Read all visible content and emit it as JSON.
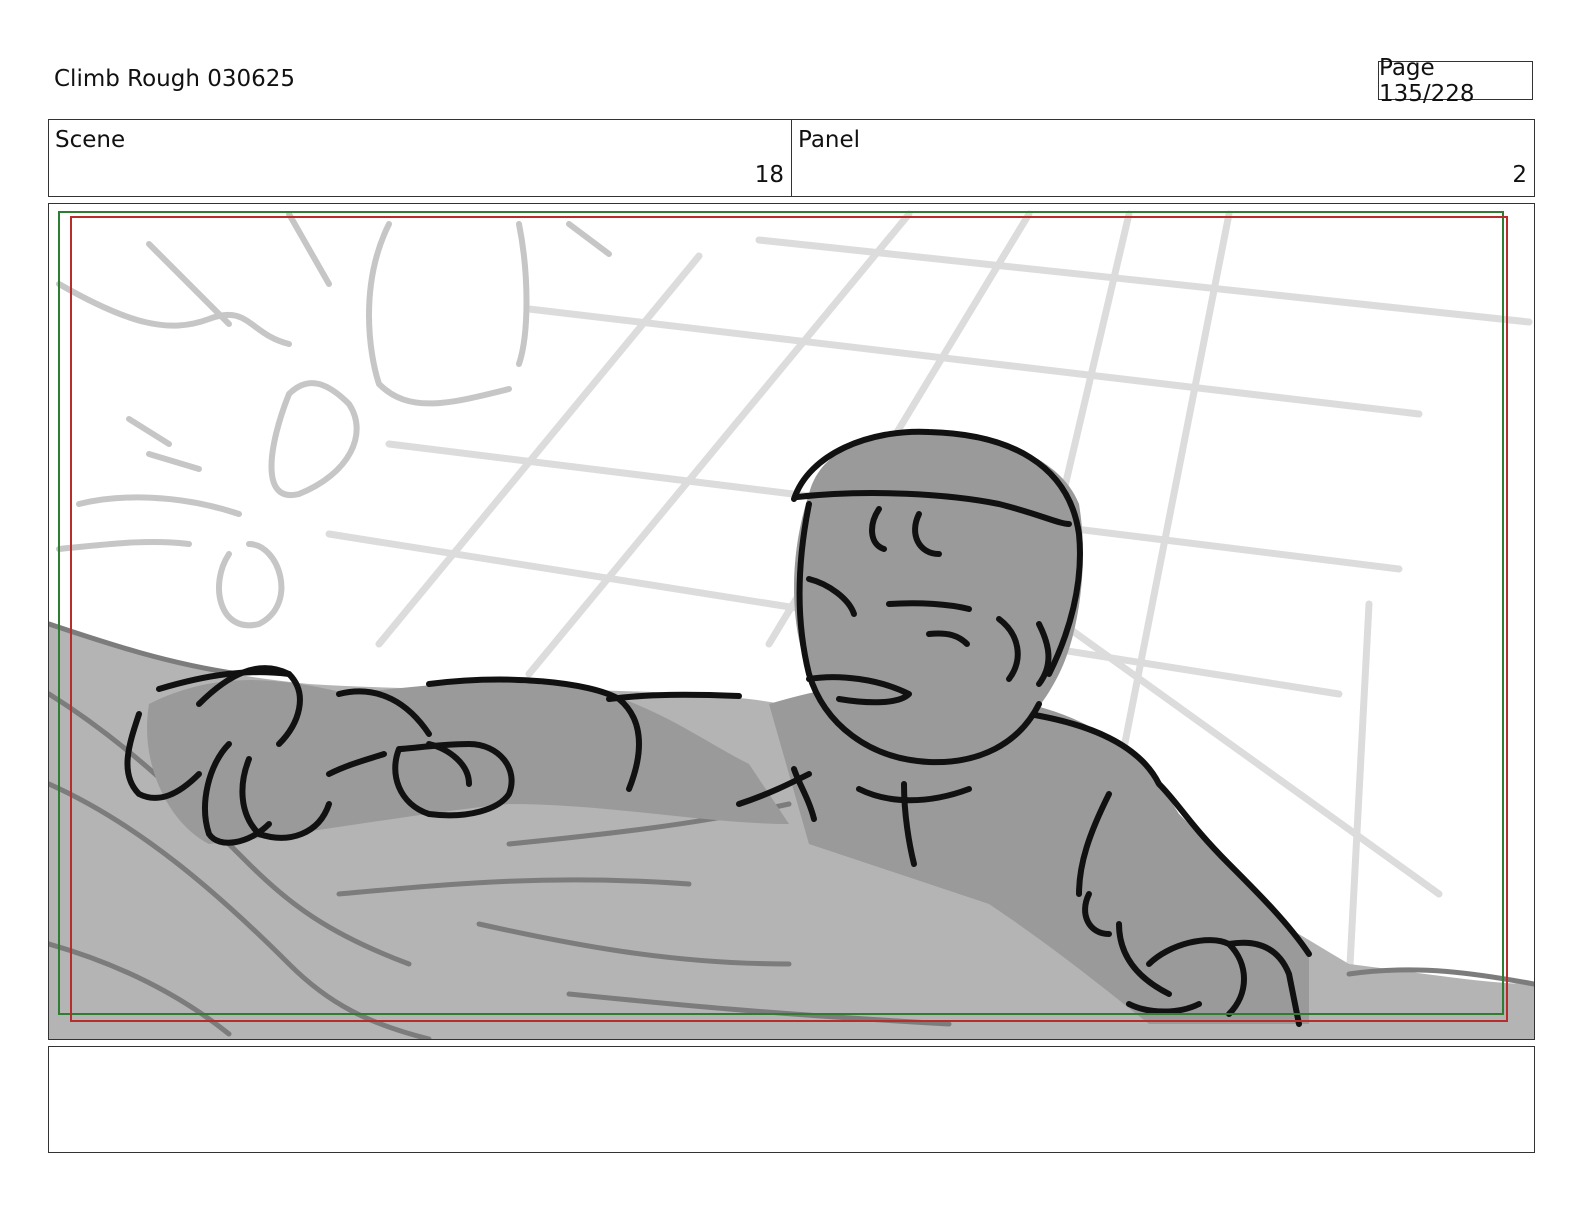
{
  "header": {
    "document_title": "Climb Rough 030625",
    "page_indicator": "Page 135/228"
  },
  "scene": {
    "label": "Scene",
    "value": "18"
  },
  "panel": {
    "label": "Panel",
    "value": "2"
  },
  "artwork": {
    "subject": "climber-pulling-up-over-ledge",
    "colors": {
      "safe_frame_red": "#b82c2c",
      "safe_frame_green": "#2e7d32",
      "ink": "#111111",
      "fill_dark": "#9a9a9a",
      "fill_light": "#b4b4b4",
      "sketch_lines": "#c8c8c8"
    }
  },
  "notes": {
    "text": ""
  }
}
